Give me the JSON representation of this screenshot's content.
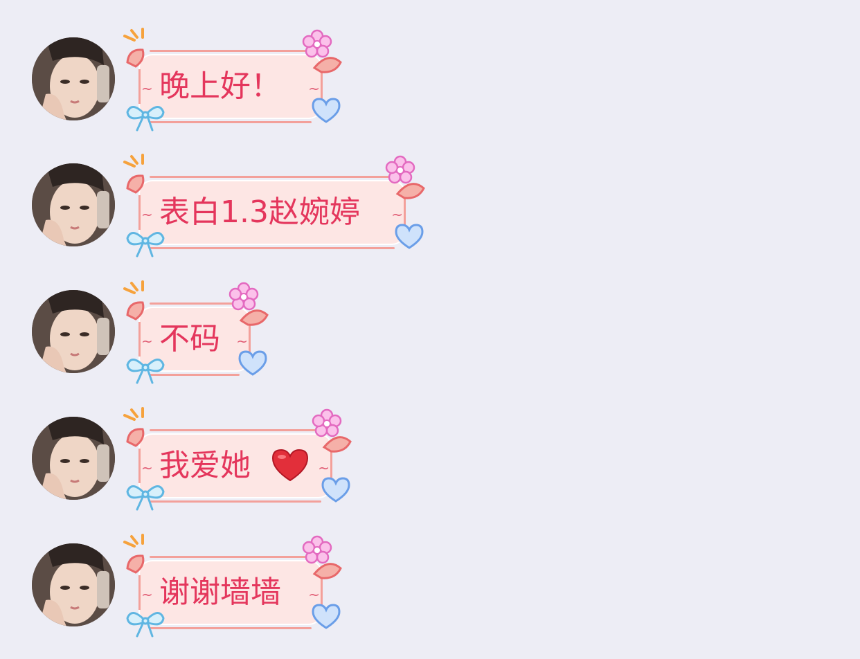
{
  "messages": [
    {
      "text": "晚上好！"
    },
    {
      "text": "表白1.3赵婉婷"
    },
    {
      "text": "不码"
    },
    {
      "text": "我爱她"
    },
    {
      "text": "谢谢墙墙"
    }
  ],
  "colors": {
    "background": "#ededf5",
    "bubble_fill": "#fde6e4",
    "bubble_border": "#f3a09a",
    "text": "#e4365c",
    "flower": "#f28cd0",
    "heart": "#9ec3f0",
    "bow": "#8fcfee",
    "sparkle": "#f6a23c"
  }
}
